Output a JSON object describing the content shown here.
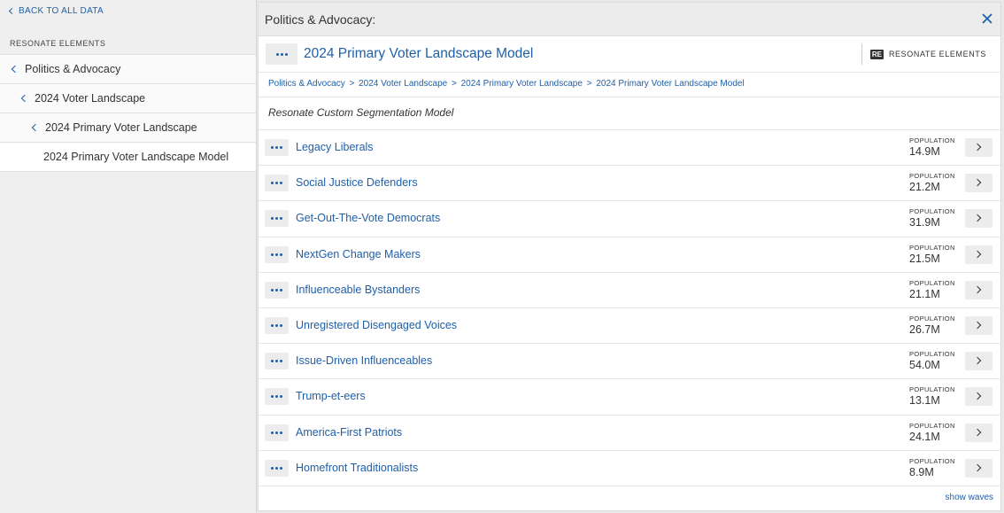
{
  "sidebar": {
    "back_label": "BACK TO ALL DATA",
    "heading": "RESONATE ELEMENTS",
    "items": [
      {
        "label": "Politics & Advocacy"
      },
      {
        "label": "2024 Voter Landscape"
      },
      {
        "label": "2024 Primary Voter Landscape"
      },
      {
        "label": "2024 Primary Voter Landscape Model"
      }
    ]
  },
  "panel": {
    "title": "Politics & Advocacy:",
    "model_title": "2024 Primary Voter Landscape Model",
    "badge_logo": "RE",
    "badge_label": "RESONATE ELEMENTS",
    "breadcrumb": [
      "Politics & Advocacy",
      "2024 Voter Landscape",
      "2024 Primary Voter Landscape",
      "2024 Primary Voter Landscape Model"
    ],
    "breadcrumb_sep": ">",
    "subtitle": "Resonate Custom Segmentation Model",
    "population_label": "POPULATION",
    "segments": [
      {
        "name": "Legacy Liberals",
        "population": "14.9M"
      },
      {
        "name": "Social Justice Defenders",
        "population": "21.2M"
      },
      {
        "name": "Get-Out-The-Vote Democrats",
        "population": "31.9M"
      },
      {
        "name": "NextGen Change Makers",
        "population": "21.5M"
      },
      {
        "name": "Influenceable Bystanders",
        "population": "21.1M"
      },
      {
        "name": "Unregistered Disengaged Voices",
        "population": "26.7M"
      },
      {
        "name": "Issue-Driven Influenceables",
        "population": "54.0M"
      },
      {
        "name": "Trump-et-eers",
        "population": "13.1M"
      },
      {
        "name": "America-First Patriots",
        "population": "24.1M"
      },
      {
        "name": "Homefront Traditionalists",
        "population": "8.9M"
      }
    ],
    "show_waves": "show waves"
  },
  "colors": {
    "accent": "#1f5fa8",
    "button_bg": "#ececec"
  },
  "icons": {
    "close": "close-icon",
    "back": "chevron-left-icon",
    "row_more": "more-dots-icon",
    "row_open": "chevron-right-icon"
  }
}
